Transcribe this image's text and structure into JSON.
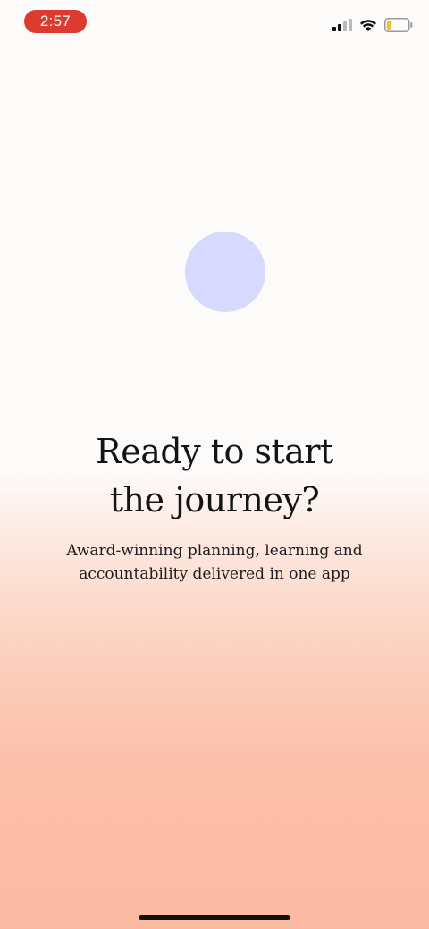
{
  "status_bar": {
    "time": "2:57",
    "time_pill_color": "#dd3b2f",
    "signal_icon": "cellular-signal-icon",
    "wifi_icon": "wifi-icon",
    "battery_icon": "battery-low-icon"
  },
  "hero": {
    "orb_color": "#d7dafe",
    "headline_line1": "Ready to start",
    "headline_line2": "the journey?",
    "subtitle_line1": "Award-winning planning, learning and",
    "subtitle_line2": "accountability delivered in one app"
  },
  "colors": {
    "background_top": "#fdfafa",
    "background_bottom": "#fbb9a2",
    "text": "#141414"
  }
}
